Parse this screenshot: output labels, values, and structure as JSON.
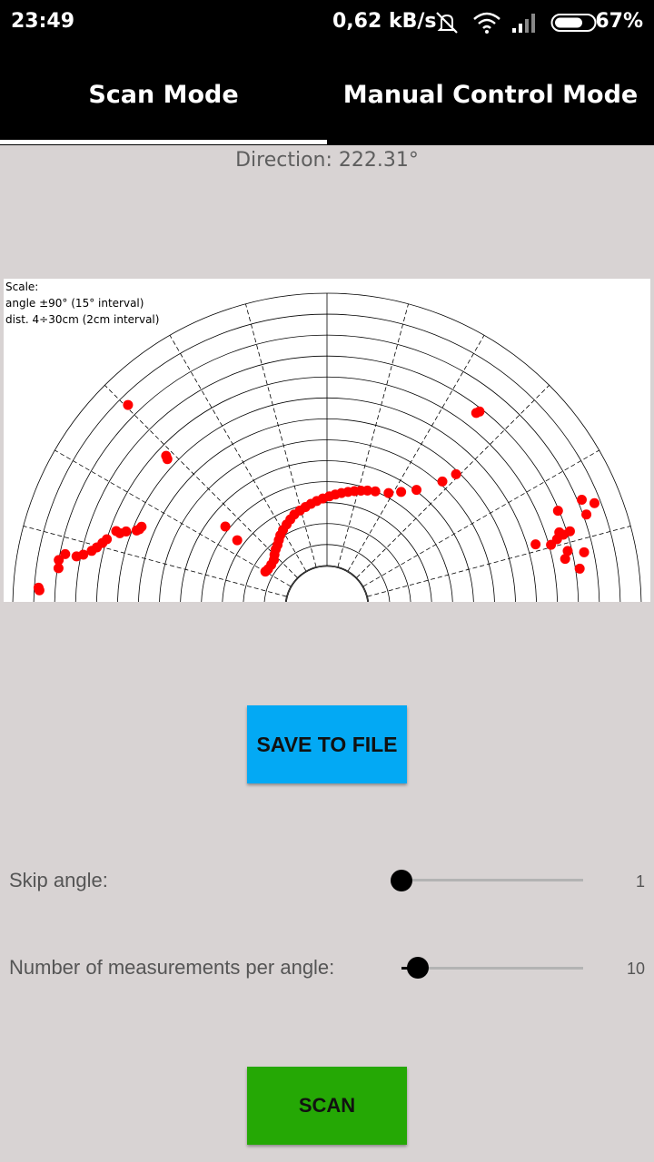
{
  "status_bar": {
    "time": "23:49",
    "speed": "0,62 kB/s",
    "battery": "67%",
    "icons": [
      "mute-icon",
      "wifi-icon",
      "signal-icon",
      "battery-icon"
    ]
  },
  "tabs": [
    {
      "label": "Scan Mode",
      "selected": true
    },
    {
      "label": "Manual Control Mode",
      "selected": false
    }
  ],
  "direction": "Direction: 222.31°",
  "plot": {
    "scale_lines": [
      "Scale:",
      "angle ±90° (15° interval)",
      "dist. 4÷30cm (2cm interval)"
    ],
    "angle_range_deg": [
      -90,
      90
    ],
    "angle_interval_deg": 15,
    "distance_range_cm": [
      4,
      30
    ],
    "distance_interval_cm": 2,
    "point_color": "#ff0000",
    "points_polar": [
      [
        -86.6,
        27.5
      ],
      [
        -86.1,
        27.6
      ],
      [
        -81.7,
        25.9
      ],
      [
        -80.0,
        26.0
      ],
      [
        -78.5,
        25.5
      ],
      [
        -78.5,
        24.4
      ],
      [
        -77.8,
        23.8
      ],
      [
        -76.5,
        23.1
      ],
      [
        -75.4,
        22.7
      ],
      [
        -74.0,
        22.3
      ],
      [
        -72.8,
        22.0
      ],
      [
        -70.1,
        21.4
      ],
      [
        -70.3,
        21.0
      ],
      [
        -69.3,
        20.5
      ],
      [
        -68.0,
        19.6
      ],
      [
        -67.4,
        19.4
      ],
      [
        -66.5,
        19.3
      ],
      [
        -44.5,
        27.1
      ],
      [
        -46.7,
        21.1
      ],
      [
        -47.1,
        20.8
      ],
      [
        -51.5,
        12.4
      ],
      [
        -53.2,
        10.7
      ],
      [
        -59.9,
        6.8
      ],
      [
        -57.1,
        6.7
      ],
      [
        -52.6,
        6.7
      ],
      [
        -48.2,
        6.8
      ],
      [
        -44.9,
        7.1
      ],
      [
        -41.4,
        7.4
      ],
      [
        -38.4,
        7.6
      ],
      [
        -35.6,
        7.9
      ],
      [
        -32.9,
        8.2
      ],
      [
        -29.6,
        8.5
      ],
      [
        -26.0,
        8.8
      ],
      [
        -22.6,
        9.1
      ],
      [
        -19.4,
        9.4
      ],
      [
        -15.6,
        9.6
      ],
      [
        -12.1,
        9.8
      ],
      [
        -8.8,
        10.0
      ],
      [
        -5.5,
        10.2
      ],
      [
        -2.2,
        10.4
      ],
      [
        1.2,
        10.6
      ],
      [
        4.2,
        10.8
      ],
      [
        7.2,
        11.0
      ],
      [
        10.3,
        11.2
      ],
      [
        13.3,
        11.4
      ],
      [
        16.2,
        11.6
      ],
      [
        19.1,
        11.8
      ],
      [
        22.6,
        12.0
      ],
      [
        28.3,
        12.4
      ],
      [
        32.7,
        13.1
      ],
      [
        37.3,
        14.1
      ],
      [
        42.5,
        16.3
      ],
      [
        44.1,
        17.7
      ],
      [
        37.5,
        23.4
      ],
      [
        37.9,
        23.7
      ],
      [
        67.3,
        23.9
      ],
      [
        67.1,
        26.4
      ],
      [
        68.7,
        27.4
      ],
      [
        70.3,
        26.3
      ],
      [
        72.6,
        24.3
      ],
      [
        72.1,
        23.3
      ],
      [
        72.9,
        23.6
      ],
      [
        73.5,
        22.9
      ],
      [
        74.4,
        22.2
      ],
      [
        73.2,
        20.8
      ],
      [
        76.8,
        23.6
      ],
      [
        78.5,
        23.2
      ],
      [
        77.9,
        25.1
      ],
      [
        81.3,
        24.4
      ]
    ]
  },
  "save_button": "SAVE TO FILE",
  "skip_angle": {
    "label": "Skip angle:",
    "value": "1",
    "fraction": 0.0
  },
  "measurements": {
    "label": "Number of measurements per angle:",
    "value": "10",
    "fraction": 0.09
  },
  "scan_button": "SCAN",
  "colors": {
    "background": "#d8d3d3",
    "save_button": "#03a9f4",
    "scan_button": "#25a805",
    "points": "#ff0000"
  }
}
